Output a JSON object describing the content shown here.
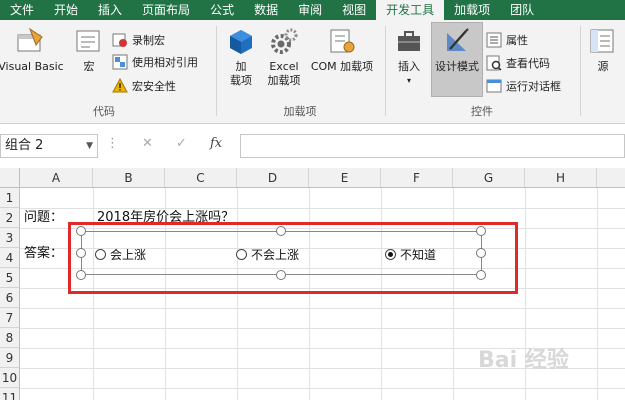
{
  "tabs": [
    "文件",
    "开始",
    "插入",
    "页面布局",
    "公式",
    "数据",
    "审阅",
    "视图",
    "开发工具",
    "加载项",
    "团队"
  ],
  "active_tab": "开发工具",
  "ribbon": {
    "code": {
      "label": "代码",
      "visual_basic": "Visual Basic",
      "macros": "宏",
      "record_macro": "录制宏",
      "relative_ref": "使用相对引用",
      "macro_security": "宏安全性"
    },
    "addins": {
      "label": "加载项",
      "addins_l1": "加",
      "addins_l2": "载项",
      "excel_l1": "Excel",
      "excel_l2": "加载项",
      "com": "COM 加载项"
    },
    "controls": {
      "label": "控件",
      "insert": "插入",
      "design_mode": "设计模式",
      "properties": "属性",
      "view_code": "查看代码",
      "run_dialog": "运行对话框"
    },
    "xml": {
      "source": "源"
    }
  },
  "formula_bar": {
    "name_box": "组合 2",
    "fx": "fx",
    "value": ""
  },
  "grid": {
    "columns": [
      "A",
      "B",
      "C",
      "D",
      "E",
      "F",
      "G",
      "H"
    ],
    "rows": [
      "1",
      "2",
      "3",
      "4",
      "5",
      "6",
      "7",
      "8",
      "9",
      "10",
      "11"
    ],
    "cells": {
      "A2": "问题：",
      "B2": "2018年房价会上涨吗？",
      "A4": "答案："
    }
  },
  "radio_options": [
    {
      "label": "会上涨",
      "checked": false
    },
    {
      "label": "不会上涨",
      "checked": false
    },
    {
      "label": "不知道",
      "checked": true
    }
  ],
  "colors": {
    "ribbon_green": "#217346",
    "highlight_red": "#e0292b"
  },
  "watermark": "Bai 经验"
}
